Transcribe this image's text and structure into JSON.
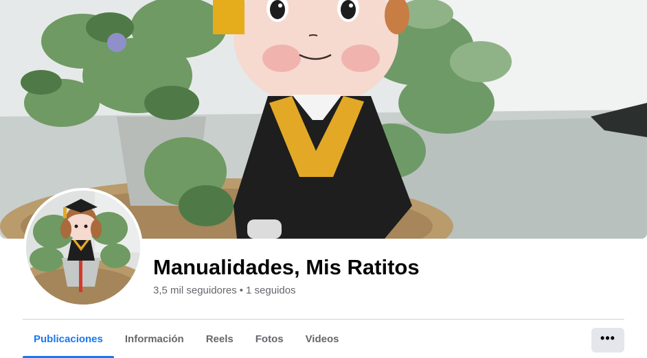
{
  "page": {
    "name": "Manualidades, Mis Ratitos",
    "followers": "3,5 mil seguidores",
    "separator": "•",
    "following": "1 seguidos"
  },
  "tabs": [
    {
      "label": "Publicaciones",
      "active": true
    },
    {
      "label": "Información",
      "active": false
    },
    {
      "label": "Reels",
      "active": false
    },
    {
      "label": "Fotos",
      "active": false
    },
    {
      "label": "Videos",
      "active": false
    }
  ],
  "more_button": {
    "icon": "more-horizontal-icon",
    "label": "•••"
  },
  "colors": {
    "accent": "#1877f2",
    "text_primary": "#050505",
    "text_secondary": "#65676b",
    "button_bg": "#e4e6eb",
    "divider": "#ced0d4"
  }
}
